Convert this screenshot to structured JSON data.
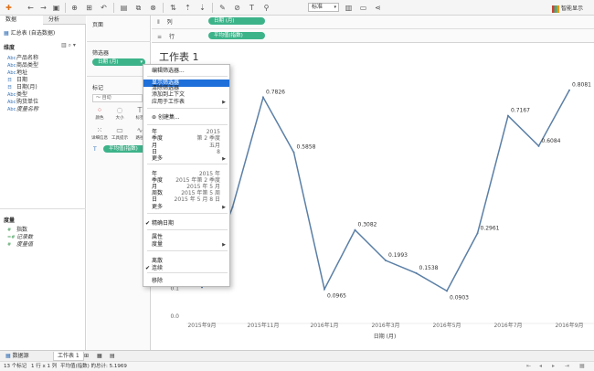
{
  "toolbar": {
    "std_label": "标准",
    "smart_label": "智能显示",
    "icons": [
      "tableau-logo",
      "back",
      "forward",
      "save",
      "new-datasource",
      "datasource",
      "undo",
      "swap",
      "sort-asc",
      "sort-desc",
      "group",
      "label",
      "highlight",
      "fit",
      "tooltip",
      "presentation",
      "share"
    ]
  },
  "left": {
    "tab_data": "数据",
    "tab_analysis": "分析",
    "datasource": "汇总表 (自选数据)",
    "dimensions_header": "维度",
    "dimensions": [
      {
        "type": "Abc",
        "label": "产品名称"
      },
      {
        "type": "Abc",
        "label": "商品类型"
      },
      {
        "type": "Abc",
        "label": "地址"
      },
      {
        "type": "日",
        "label": "日期"
      },
      {
        "type": "日",
        "label": "日期(月)"
      },
      {
        "type": "Abc",
        "label": "类型"
      },
      {
        "type": "Abc",
        "label": "购货单位"
      },
      {
        "type": "Abc",
        "label": "度量名称",
        "italic": true
      }
    ],
    "measures_header": "度量",
    "measures": [
      {
        "type": "#",
        "label": "指数"
      },
      {
        "type": "=#",
        "label": "记录数",
        "italic": true
      },
      {
        "type": "#",
        "label": "度量值",
        "italic": true
      }
    ]
  },
  "middle": {
    "pages_label": "页面",
    "filters_label": "筛选器",
    "filter_pill": "日期 (月)",
    "marks_label": "标记",
    "mark_type": "自动",
    "mark_buttons": [
      "颜色",
      "大小",
      "标签",
      "详细信息",
      "工具提示",
      "路径"
    ],
    "mark_pill": "平均值(指数)"
  },
  "shelves": {
    "columns_label": "列",
    "rows_label": "行",
    "columns_pill": "日期 (月)",
    "rows_pill": "平均值(指数)"
  },
  "sheet": {
    "title": "工作表 1"
  },
  "context_menu": {
    "items": [
      {
        "label": "编辑筛选器...",
        "value": "",
        "arrow": false,
        "check": false,
        "highlight": false
      },
      {
        "label": "显示筛选器",
        "value": "",
        "arrow": false,
        "check": false,
        "highlight": true
      },
      {
        "label": "清除筛选器",
        "value": "",
        "arrow": false,
        "check": false,
        "highlight": false
      },
      {
        "label": "添加到上下文",
        "value": "",
        "arrow": false,
        "check": false,
        "highlight": false
      },
      {
        "label": "应用于工作表",
        "value": "",
        "arrow": true,
        "check": false,
        "highlight": false
      },
      {
        "label": "创建集...",
        "value": "",
        "arrow": false,
        "check": false,
        "highlight": false
      },
      {
        "label": "年",
        "value": "2015",
        "arrow": false,
        "check": false,
        "highlight": false
      },
      {
        "label": "季度",
        "value": "第 2 季度",
        "arrow": false,
        "check": false,
        "highlight": false
      },
      {
        "label": "月",
        "value": "五月",
        "arrow": false,
        "check": false,
        "highlight": false
      },
      {
        "label": "日",
        "value": "8",
        "arrow": false,
        "check": false,
        "highlight": false
      },
      {
        "label": "更多",
        "value": "",
        "arrow": true,
        "check": false,
        "highlight": false
      },
      {
        "label": "年",
        "value": "2015 年",
        "arrow": false,
        "check": false,
        "highlight": false
      },
      {
        "label": "季度",
        "value": "2015 年第 2 季度",
        "arrow": false,
        "check": false,
        "highlight": false
      },
      {
        "label": "月",
        "value": "2015 年 5 月",
        "arrow": false,
        "check": false,
        "highlight": false
      },
      {
        "label": "周数",
        "value": "2015 年第 5 周",
        "arrow": false,
        "check": false,
        "highlight": false
      },
      {
        "label": "日",
        "value": "2015 年 5 月 8 日",
        "arrow": false,
        "check": false,
        "highlight": false
      },
      {
        "label": "更多",
        "value": "",
        "arrow": true,
        "check": false,
        "highlight": false
      },
      {
        "label": "精确日期",
        "value": "",
        "arrow": false,
        "check": true,
        "highlight": false
      },
      {
        "label": "属性",
        "value": "",
        "arrow": false,
        "check": false,
        "highlight": false
      },
      {
        "label": "度量",
        "value": "",
        "arrow": true,
        "check": false,
        "highlight": false
      },
      {
        "label": "离散",
        "value": "",
        "arrow": false,
        "check": false,
        "highlight": false
      },
      {
        "label": "连续",
        "value": "",
        "arrow": false,
        "check": true,
        "highlight": false
      },
      {
        "label": "移除",
        "value": "",
        "arrow": false,
        "check": false,
        "highlight": false
      }
    ]
  },
  "chart_data": {
    "type": "line",
    "title": "工作表 1",
    "xlabel": "日期 (月)",
    "ylabel": "",
    "x_ticks": [
      "2015年9月",
      "2015年11月",
      "2016年1月",
      "2016年3月",
      "2016年5月",
      "2016年7月",
      "2016年9月"
    ],
    "y_ticks": [
      "0.0",
      "0.1"
    ],
    "series": [
      {
        "color": "#5b7fa6",
        "points": [
          {
            "x": "2015-09-01",
            "y": 0.1035
          },
          {
            "x": "2015-10-01",
            "y": 0.39
          },
          {
            "x": "2015-11-01",
            "y": 0.7826
          },
          {
            "x": "2015-12-01",
            "y": 0.5858
          },
          {
            "x": "2016-01-01",
            "y": 0.0965
          },
          {
            "x": "2016-02-01",
            "y": 0.3082
          },
          {
            "x": "2016-03-01",
            "y": 0.1993
          },
          {
            "x": "2016-04-01",
            "y": 0.1538
          },
          {
            "x": "2016-05-01",
            "y": 0.0903
          },
          {
            "x": "2016-06-01",
            "y": 0.2961
          },
          {
            "x": "2016-07-01",
            "y": 0.7167
          },
          {
            "x": "2016-08-01",
            "y": 0.6084
          },
          {
            "x": "2016-09-01",
            "y": 0.8081
          }
        ]
      }
    ],
    "data_labels": [
      "0.1035",
      "",
      "0.7826",
      "0.5858",
      "0.0965",
      "0.3082",
      "0.1993",
      "0.1538",
      "0.0903",
      "0.2961",
      "0.7167",
      "0.6084",
      "0.8081"
    ],
    "ylim": [
      0,
      0.85
    ]
  },
  "bottom": {
    "tab_datasource": "数据源",
    "tab_sheet": "工作表 1"
  },
  "status": {
    "marks": "13 个标记",
    "rowscols": "1 行 x 1 列",
    "sum": "平均值(指数) 的总计: 5.1969"
  }
}
